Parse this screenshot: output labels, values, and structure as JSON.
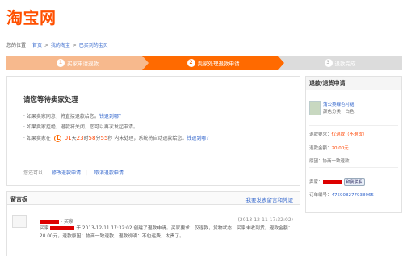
{
  "logo": "淘宝网",
  "breadcrumb": {
    "label": "您的位置：",
    "items": [
      "首页",
      "我的淘宝",
      "已买到的宝贝"
    ],
    "separator": ">"
  },
  "steps": [
    {
      "num": "1",
      "label": "买家申请退款"
    },
    {
      "num": "2",
      "label": "卖家处理退款申请"
    },
    {
      "num": "3",
      "label": "退款完成"
    }
  ],
  "main": {
    "title": "请您等待卖家处理",
    "tips": [
      {
        "text": "· 如果卖家同意，将直接退款给您。",
        "link": "钱退到哪？"
      },
      {
        "text": "· 如果卖家拒绝，退款将关闭，您可以再次发起申请。",
        "link": ""
      }
    ],
    "countdown": {
      "prefix": "· 如果卖家在",
      "days": "01",
      "days_unit": "天",
      "hours": "23",
      "hours_unit": "时",
      "minutes": "58",
      "minutes_unit": "分",
      "seconds": "55",
      "seconds_unit": "秒",
      "suffix": " 内未处理，系统将自动退款给您。",
      "link": "钱退到哪？"
    },
    "actions": {
      "label": "您还可以：",
      "modify": "修改退款申请",
      "cancel": "取消退款申请"
    }
  },
  "side": {
    "title": "退款/退货申请",
    "product_name": "蒲公英绿色衬裙",
    "product_color": "颜色分类：白色",
    "refund_request_label": "退款要求：",
    "refund_request_value": "仅退款（不退货）",
    "refund_amount_label": "退款金额：",
    "refund_amount_value": "20.00元",
    "reason_label": "原因：",
    "reason_value": "协商一致退款",
    "seller_label": "卖家：",
    "seller_badge": "和我联系",
    "order_label": "订单编号：",
    "order_value": "475908277938965"
  },
  "messages": {
    "title": "留言板",
    "post_link": "我要发表留言和凭证",
    "author_suffix": "- 买家",
    "time": "(2013-12-11 17:32:02)",
    "body_prefix": "买家",
    "body": "于 2013-12-11 17:32:02 创建了退款申请。买家要求：仅退款，货物状态：买家未收到货，退款金额：20.00元，退款原因：协商一致退款，退款说明：不包运费，太贵了。"
  },
  "colors": {
    "brand": "#ff5000",
    "step_active": "#ff6a00",
    "link": "#3366cc",
    "alert": "#f40"
  }
}
